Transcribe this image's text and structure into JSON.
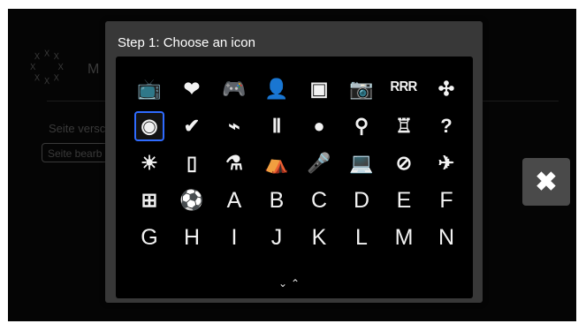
{
  "background_app": {
    "logo_glyph": "꙰",
    "title": "M",
    "label": "Seite versc",
    "field_value": "Seite bearb"
  },
  "dialog": {
    "title": "Step 1: Choose an icon",
    "icons": [
      {
        "name": "tv-icon",
        "glyph": "📺"
      },
      {
        "name": "heart-icon",
        "glyph": "❤"
      },
      {
        "name": "gamepad-icon",
        "glyph": "🎮"
      },
      {
        "name": "person-icon",
        "glyph": "👤"
      },
      {
        "name": "picture-frame-icon",
        "glyph": "▣"
      },
      {
        "name": "camera-icon",
        "glyph": "📷"
      },
      {
        "name": "group-icon",
        "glyph": "ᴿᴿᴿ"
      },
      {
        "name": "clover-icon",
        "glyph": "✣"
      },
      {
        "name": "phone-dial-icon",
        "glyph": "◉",
        "selected": true
      },
      {
        "name": "checkmark-icon",
        "glyph": "✔"
      },
      {
        "name": "plug-icon",
        "glyph": "⌁"
      },
      {
        "name": "column-icon",
        "glyph": "Ⅱ"
      },
      {
        "name": "disc-icon",
        "glyph": "●"
      },
      {
        "name": "desk-lamp-icon",
        "glyph": "⚲"
      },
      {
        "name": "robot-icon",
        "glyph": "♖"
      },
      {
        "name": "question-icon",
        "glyph": "?"
      },
      {
        "name": "sunrise-icon",
        "glyph": "☀"
      },
      {
        "name": "remote-icon",
        "glyph": "▯"
      },
      {
        "name": "flask-icon",
        "glyph": "⚗"
      },
      {
        "name": "cloche-icon",
        "glyph": "⛺"
      },
      {
        "name": "microphone-icon",
        "glyph": "🎤"
      },
      {
        "name": "laptop-icon",
        "glyph": "💻"
      },
      {
        "name": "no-entry-icon",
        "glyph": "⊘"
      },
      {
        "name": "rocket-icon",
        "glyph": "✈"
      },
      {
        "name": "first-aid-icon",
        "glyph": "⊞"
      },
      {
        "name": "ball-icon",
        "glyph": "⚽"
      },
      {
        "name": "letter-a",
        "glyph": "A",
        "letter": true
      },
      {
        "name": "letter-b",
        "glyph": "B",
        "letter": true
      },
      {
        "name": "letter-c",
        "glyph": "C",
        "letter": true
      },
      {
        "name": "letter-d",
        "glyph": "D",
        "letter": true
      },
      {
        "name": "letter-e",
        "glyph": "E",
        "letter": true
      },
      {
        "name": "letter-f",
        "glyph": "F",
        "letter": true
      },
      {
        "name": "letter-g",
        "glyph": "G",
        "letter": true
      },
      {
        "name": "letter-h",
        "glyph": "H",
        "letter": true
      },
      {
        "name": "letter-i",
        "glyph": "I",
        "letter": true
      },
      {
        "name": "letter-j",
        "glyph": "J",
        "letter": true
      },
      {
        "name": "letter-k",
        "glyph": "K",
        "letter": true
      },
      {
        "name": "letter-l",
        "glyph": "L",
        "letter": true
      },
      {
        "name": "letter-m",
        "glyph": "M",
        "letter": true
      },
      {
        "name": "letter-n",
        "glyph": "N",
        "letter": true
      }
    ],
    "scroll_arrows": "⌄⌃"
  },
  "close_button": {
    "glyph": "✖",
    "icon": "close-icon"
  },
  "colors": {
    "selection": "#2f6bff",
    "dialog_bg": "#383838",
    "panel_bg": "#000000"
  }
}
